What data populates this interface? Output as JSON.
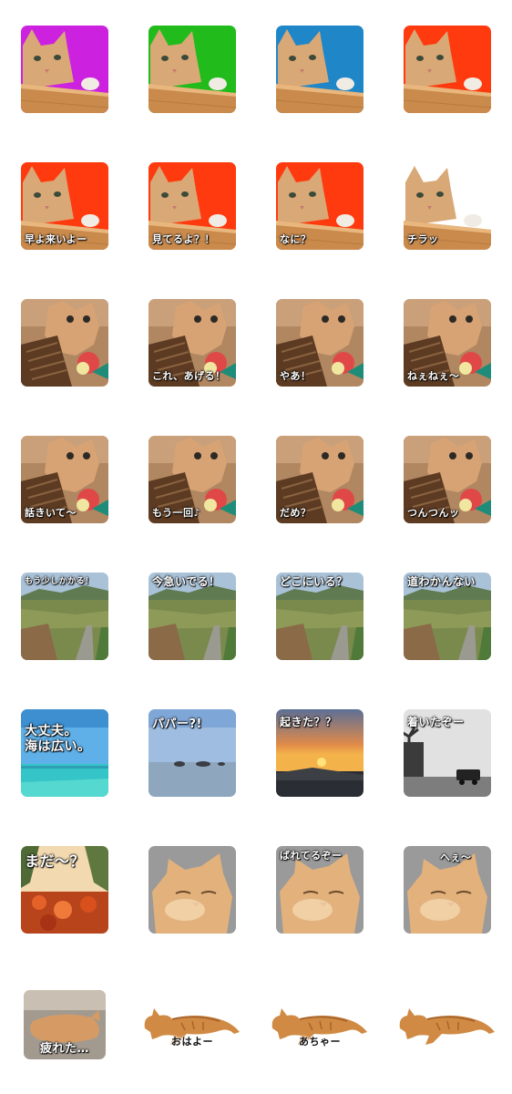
{
  "stickers": [
    {
      "id": "s01",
      "scene": "window-cat",
      "bg": "#cc22e0",
      "caption": ""
    },
    {
      "id": "s02",
      "scene": "window-cat",
      "bg": "#22bb1c",
      "caption": ""
    },
    {
      "id": "s03",
      "scene": "window-cat",
      "bg": "#1f86c8",
      "caption": ""
    },
    {
      "id": "s04",
      "scene": "window-cat",
      "bg": "#ff3a0e",
      "caption": ""
    },
    {
      "id": "s05",
      "scene": "window-cat",
      "bg": "#ff3a0e",
      "caption": "早よ来いよー"
    },
    {
      "id": "s06",
      "scene": "window-cat",
      "bg": "#ff3a0e",
      "caption": "見てるよ？！"
    },
    {
      "id": "s07",
      "scene": "window-cat",
      "bg": "#ff3a0e",
      "caption": "なに？"
    },
    {
      "id": "s08",
      "scene": "window-cat",
      "bg": "#ffffff",
      "caption": "チラッ"
    },
    {
      "id": "s09",
      "scene": "kitten",
      "bg": "#b98a5e",
      "caption": ""
    },
    {
      "id": "s10",
      "scene": "kitten",
      "bg": "#b98a5e",
      "caption": "これ、あげる！"
    },
    {
      "id": "s11",
      "scene": "kitten",
      "bg": "#b98a5e",
      "caption": "やあ！"
    },
    {
      "id": "s12",
      "scene": "kitten",
      "bg": "#b98a5e",
      "caption": "ねぇねぇ〜"
    },
    {
      "id": "s13",
      "scene": "kitten",
      "bg": "#b98a5e",
      "caption": "話きいて〜"
    },
    {
      "id": "s14",
      "scene": "kitten",
      "bg": "#b98a5e",
      "caption": "もう一回♪"
    },
    {
      "id": "s15",
      "scene": "kitten",
      "bg": "#b98a5e",
      "caption": "だめ？"
    },
    {
      "id": "s16",
      "scene": "kitten",
      "bg": "#b98a5e",
      "caption": "つんつんッ"
    },
    {
      "id": "s17",
      "scene": "field",
      "bg": "#9eb7cf",
      "caption": "もう少しかかる！"
    },
    {
      "id": "s18",
      "scene": "field",
      "bg": "#9eb7cf",
      "caption": "今急いでる！"
    },
    {
      "id": "s19",
      "scene": "field",
      "bg": "#9eb7cf",
      "caption": "どこにいる？"
    },
    {
      "id": "s20",
      "scene": "field",
      "bg": "#9eb7cf",
      "caption": "道わかんない"
    },
    {
      "id": "s21",
      "scene": "sea",
      "bg": "#4aa2d8",
      "caption": "大丈夫。\n海は広い。"
    },
    {
      "id": "s22",
      "scene": "bay",
      "bg": "#8fb3d9",
      "caption": "パパー?!"
    },
    {
      "id": "s23",
      "scene": "sunset",
      "bg": "#5a6a86",
      "caption": "起きた？？"
    },
    {
      "id": "s24",
      "scene": "road",
      "bg": "#d8d8d8",
      "caption": "着いたぞー"
    },
    {
      "id": "s25",
      "scene": "flowers",
      "bg": "#d86a2a",
      "caption": "まだ〜？"
    },
    {
      "id": "s26",
      "scene": "sleepy-cat",
      "bg": "#9b9b9b",
      "caption": ""
    },
    {
      "id": "s27",
      "scene": "sleepy-cat",
      "bg": "#9b9b9b",
      "caption": "ばれてるぞー"
    },
    {
      "id": "s28",
      "scene": "sleepy-cat",
      "bg": "#9b9b9b",
      "caption": "へぇ〜"
    },
    {
      "id": "s29",
      "scene": "tired-cat",
      "bg": "#a99f93",
      "caption": "疲れた…"
    },
    {
      "id": "s30",
      "scene": "stretch-cat",
      "bg": "#ffffff",
      "caption": "おはよー"
    },
    {
      "id": "s31",
      "scene": "stretch-cat",
      "bg": "#ffffff",
      "caption": "あちゃー"
    },
    {
      "id": "s32",
      "scene": "stretch-cat",
      "bg": "#ffffff",
      "caption": ""
    }
  ]
}
